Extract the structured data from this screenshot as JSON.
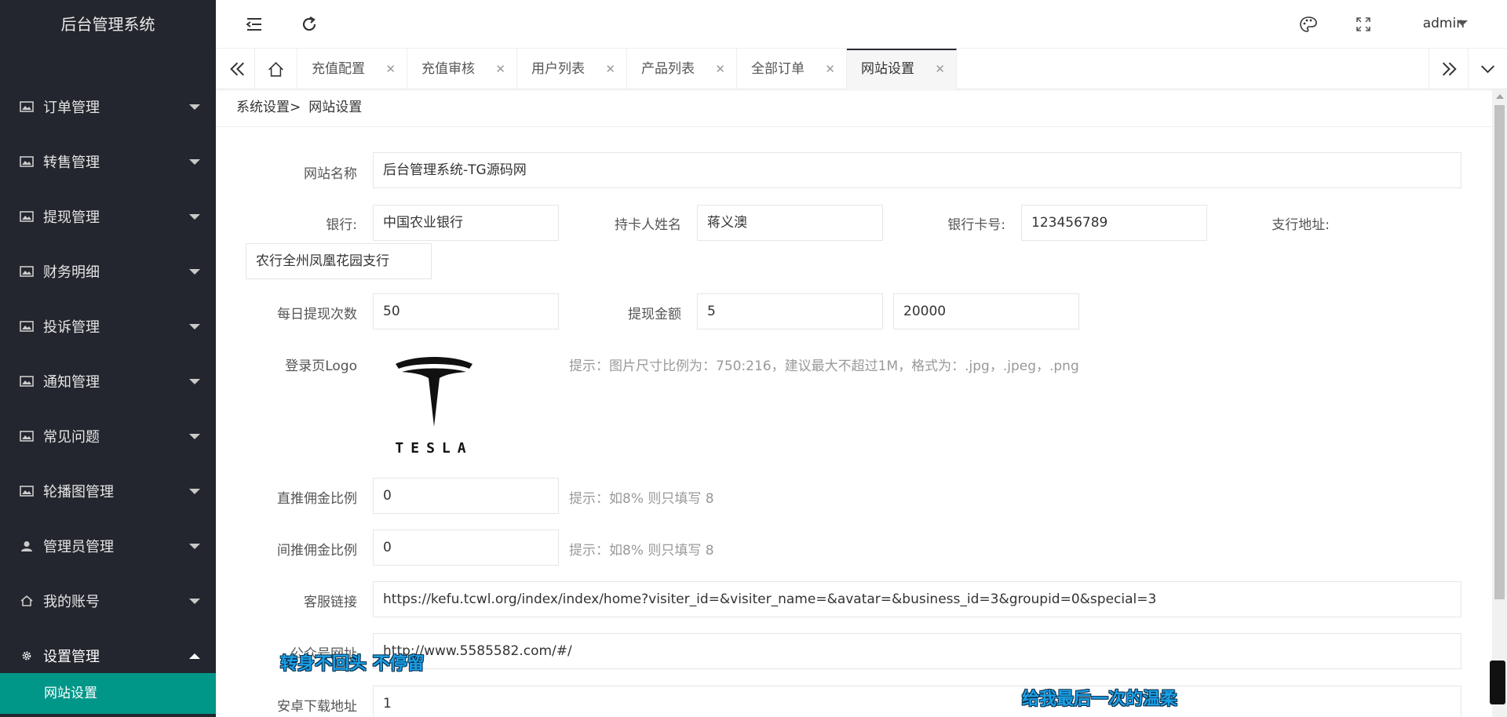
{
  "app": {
    "title": "后台管理系统"
  },
  "sidebar": {
    "items": [
      {
        "label": "订单管理",
        "icon": "image-icon"
      },
      {
        "label": "转售管理",
        "icon": "image-icon"
      },
      {
        "label": "提现管理",
        "icon": "image-icon"
      },
      {
        "label": "财务明细",
        "icon": "image-icon"
      },
      {
        "label": "投诉管理",
        "icon": "image-icon"
      },
      {
        "label": "通知管理",
        "icon": "image-icon"
      },
      {
        "label": "常见问题",
        "icon": "image-icon"
      },
      {
        "label": "轮播图管理",
        "icon": "image-icon"
      },
      {
        "label": "管理员管理",
        "icon": "user-icon"
      },
      {
        "label": "我的账号",
        "icon": "home-icon"
      },
      {
        "label": "设置管理",
        "icon": "gear-icon"
      }
    ],
    "active_sub": "网站设置"
  },
  "header": {
    "user": "admin"
  },
  "tabs": [
    {
      "label": "充值配置"
    },
    {
      "label": "充值审核"
    },
    {
      "label": "用户列表"
    },
    {
      "label": "产品列表"
    },
    {
      "label": "全部订单"
    },
    {
      "label": "网站设置"
    }
  ],
  "breadcrumb": {
    "parent": "系统设置>",
    "current": "网站设置"
  },
  "form": {
    "site_name_label": "网站名称",
    "site_name": "后台管理系统-TG源码网",
    "bank_label": "银行:",
    "bank": "中国农业银行",
    "holder_label": "持卡人姓名",
    "holder": "蒋义澳",
    "card_label": "银行卡号:",
    "card": "123456789",
    "branch_label": "支行地址:",
    "branch": "农行全州凤凰花园支行",
    "daily_label": "每日提现次数",
    "daily": "50",
    "amount_label": "提现金额",
    "amount_min": "5",
    "amount_max": "20000",
    "logo_label": "登录页Logo",
    "logo_text": "TESLA",
    "logo_hint": "提示：图片尺寸比例为：750:216，建议最大不超过1M，格式为：.jpg，.jpeg，.png",
    "direct_label": "直推佣金比例",
    "direct": "0",
    "direct_hint": "提示：如8% 则只填写 8",
    "indirect_label": "间推佣金比例",
    "indirect": "0",
    "indirect_hint": "提示：如8% 则只填写 8",
    "service_label": "客服链接",
    "service": "https://kefu.tcwl.org/index/index/home?visiter_id=&visiter_name=&avatar=&business_id=3&groupid=0&special=3",
    "pc_label": "公众号网址",
    "pc": "http://www.5585582.com/#/",
    "android_label": "安卓下载地址",
    "android": "1"
  },
  "overlay": {
    "subtitle_left": "转身不回头 不停留",
    "subtitle_right": "给我最后一次的温柔"
  },
  "colors": {
    "sidebar": "#23262e",
    "accent": "#009688"
  }
}
